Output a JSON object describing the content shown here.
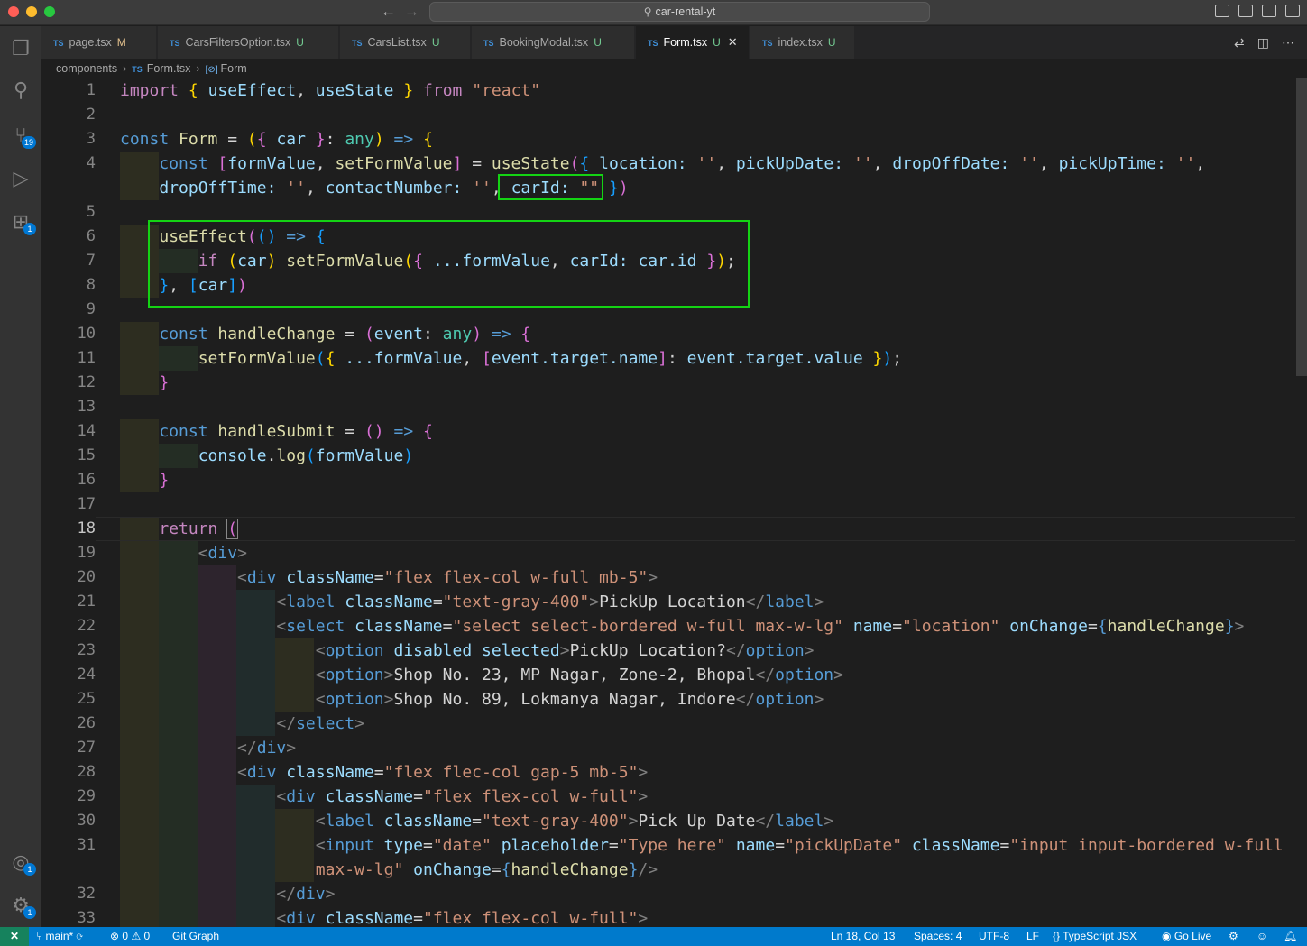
{
  "titlebar": {
    "back_icon": "arrow-left-icon",
    "forward_icon": "arrow-right-icon",
    "search_text": "car-rental-yt"
  },
  "tabs": [
    {
      "label": "page.tsx",
      "status": "M",
      "lang": "TS"
    },
    {
      "label": "CarsFiltersOption.tsx",
      "status": "U",
      "lang": "TS"
    },
    {
      "label": "CarsList.tsx",
      "status": "U",
      "lang": "TS"
    },
    {
      "label": "BookingModal.tsx",
      "status": "U",
      "lang": "TS"
    },
    {
      "label": "Form.tsx",
      "status": "U",
      "lang": "TS",
      "active": true
    },
    {
      "label": "index.tsx",
      "status": "U",
      "lang": "TS"
    }
  ],
  "breadcrumb": {
    "folder": "components",
    "file": "Form.tsx",
    "symbol": "Form",
    "lang": "TS"
  },
  "activity": {
    "scm_badge": "19",
    "extensions_badge": "1",
    "accounts_badge": "1",
    "settings_badge": "1"
  },
  "editor": {
    "line_numbers": [
      "1",
      "2",
      "3",
      "4",
      "",
      "5",
      "6",
      "7",
      "8",
      "9",
      "10",
      "11",
      "12",
      "13",
      "14",
      "15",
      "16",
      "17",
      "18",
      "19",
      "20",
      "21",
      "22",
      "23",
      "24",
      "25",
      "26",
      "27",
      "28",
      "29",
      "30",
      "31",
      "",
      "32",
      "33"
    ],
    "current_line": "18"
  },
  "code": {
    "l1_import": "import",
    "l1_use_effect": "useEffect",
    "l1_use_state": "useState",
    "l1_from": "from",
    "l1_react": "\"react\"",
    "l3_const": "const",
    "l3_form": "Form",
    "l3_car": "car",
    "l3_any": "any",
    "l4_text_a": "formValue",
    "l4_text_b": "setFormValue",
    "l4_usestate": "useState",
    "l4_location": "location:",
    "l4_pickupdate": "pickUpDate:",
    "l4_dropoffdate": "dropOffDate:",
    "l4_pickuptime": "pickUpTime:",
    "l4b_dropofftime": "dropOffTime:",
    "l4b_contact": "contactNumber:",
    "l4b_carid": "carId:",
    "l4b_carid_val": "\"\"",
    "l6_useeffect": "useEffect",
    "l7_if": "if",
    "l7_car": "car",
    "l7_set": "setFormValue",
    "l7_formvalue": "...formValue",
    "l7_carid": "carId:",
    "l7_carid_val": "car.id",
    "l8_car": "car",
    "l10_name": "handleChange",
    "l10_event": "event",
    "l10_any": "any",
    "l11_set": "setFormValue",
    "l11_formvalue": "...formValue",
    "l11_key": "event.target.name",
    "l11_val": "event.target.value",
    "l14_name": "handleSubmit",
    "l15_console": "console",
    "l15_log": "log",
    "l15_arg": "formValue",
    "l18_return": "return",
    "s_div": "div",
    "s_label": "label",
    "s_select": "select",
    "s_option": "option",
    "s_input": "input",
    "a_classname": "className",
    "a_name": "name",
    "a_onchange": "onChange",
    "a_disabled": "disabled",
    "a_selected": "selected",
    "a_type": "type",
    "a_placeholder": "placeholder",
    "l20_cls": "\"flex flex-col w-full mb-5\"",
    "l21_cls": "\"text-gray-400\"",
    "l21_text": "PickUp Location",
    "l22_cls": "\"select select-bordered w-full max-w-lg\"",
    "l22_name": "\"location\"",
    "l22_handler": "handleChange",
    "l23_text": "PickUp Location?",
    "l24_text": "Shop No. 23, MP Nagar, Zone-2, Bhopal",
    "l25_text": "Shop No. 89, Lokmanya Nagar, Indore",
    "l28_cls": "\"flex flec-col gap-5 mb-5\"",
    "l29_cls": "\"flex flex-col w-full\"",
    "l30_cls": "\"text-gray-400\"",
    "l30_text": "Pick Up Date",
    "l31_type": "\"date\"",
    "l31_placeholder": "\"Type here\"",
    "l31_name": "\"pickUpDate\"",
    "l31_cls": "\"input input-bordered w-full",
    "l31b_cls": "max-w-lg\"",
    "l31b_handler": "handleChange",
    "l33_cls": "\"flex flex-col w-full\""
  },
  "status": {
    "branch": "main*",
    "errors": "0",
    "warnings": "0",
    "git_graph": "Git Graph",
    "position": "Ln 18, Col 13",
    "spaces": "Spaces: 4",
    "encoding": "UTF-8",
    "eol": "LF",
    "language": "TypeScript JSX",
    "go_live": "Go Live"
  },
  "colors": {
    "highlight_box": "#14d314",
    "statusbar": "#007acc",
    "remote": "#16825d"
  }
}
